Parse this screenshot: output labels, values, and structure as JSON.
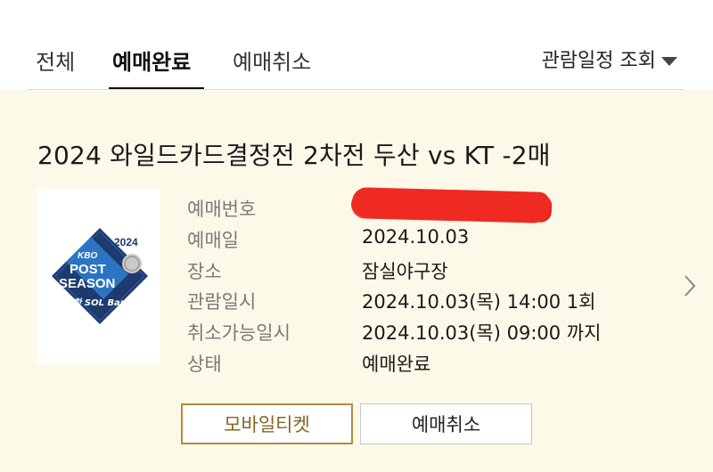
{
  "tabs": [
    {
      "label": "전체"
    },
    {
      "label": "예매완료",
      "active": true
    },
    {
      "label": "예매취소"
    }
  ],
  "view_schedule_label": "관람일정 조회",
  "booking": {
    "title": "2024 와일드카드결정전 2차전 두산 vs KT -2매",
    "logo": {
      "kbo": "KBO",
      "year": "2024",
      "line1": "POST",
      "line2": "SEASON",
      "sponsor": "신한 SOL Bank"
    },
    "details": [
      {
        "label": "예매번호",
        "value": ""
      },
      {
        "label": "예매일",
        "value": "2024.10.03"
      },
      {
        "label": "장소",
        "value": "잠실야구장"
      },
      {
        "label": "관람일시",
        "value": "2024.10.03(목) 14:00 1회"
      },
      {
        "label": "취소가능일시",
        "value": "2024.10.03(목) 09:00 까지"
      },
      {
        "label": "상태",
        "value": "예매완료"
      }
    ],
    "buttons": {
      "mobile_ticket": "모바일티켓",
      "cancel": "예매취소"
    }
  },
  "colors": {
    "card_background": "#fdf9e8",
    "logo_navy": "#1e3a6e",
    "logo_blue": "#2f7fd0",
    "button_gold": "#b8893a",
    "redaction": "#ee2a22"
  }
}
